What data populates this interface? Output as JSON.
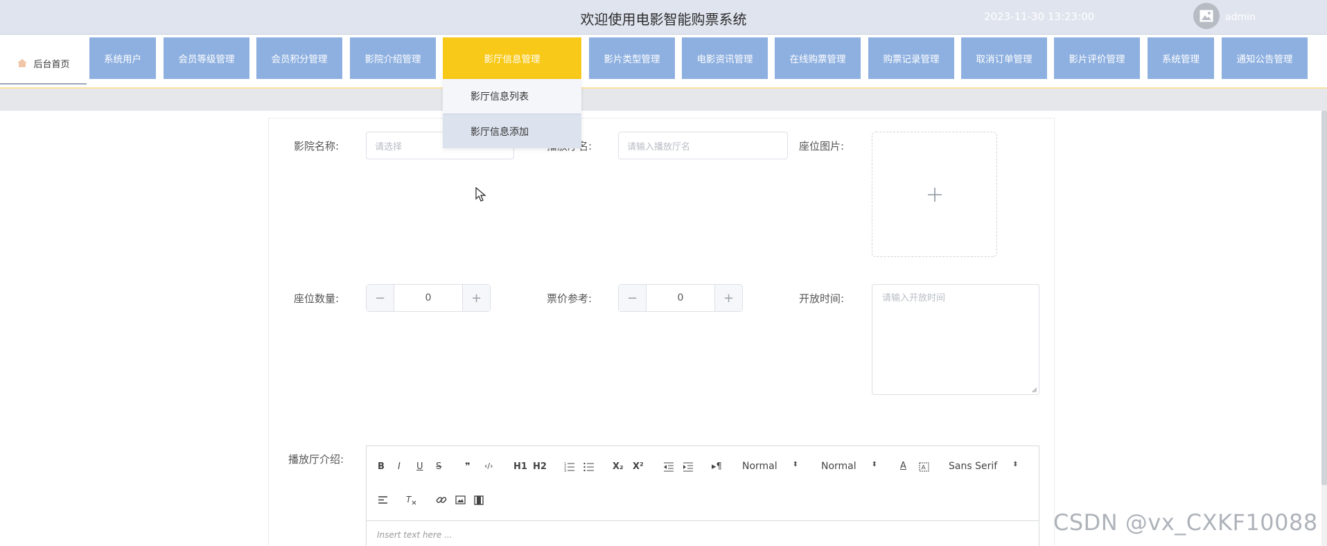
{
  "header": {
    "title": "欢迎使用电影智能购票系统",
    "datetime": "2023-11-30 13:23:00",
    "username": "admin"
  },
  "nav": {
    "home_label": "后台首页",
    "items": [
      {
        "label": "系统用户"
      },
      {
        "label": "会员等级管理"
      },
      {
        "label": "会员积分管理"
      },
      {
        "label": "影院介绍管理"
      },
      {
        "label": "影厅信息管理",
        "active": true
      },
      {
        "label": "影片类型管理"
      },
      {
        "label": "电影资讯管理"
      },
      {
        "label": "在线购票管理"
      },
      {
        "label": "购票记录管理"
      },
      {
        "label": "取消订单管理"
      },
      {
        "label": "影片评价管理"
      },
      {
        "label": "系统管理"
      },
      {
        "label": "通知公告管理"
      }
    ],
    "dropdown": [
      {
        "label": "影厅信息列表"
      },
      {
        "label": "影厅信息添加"
      }
    ]
  },
  "form": {
    "cinema_name": {
      "label": "影院名称:",
      "placeholder": "请选择"
    },
    "hall_name": {
      "label": "播放厅名:",
      "placeholder": "请输入播放厅名"
    },
    "seat_image": {
      "label": "座位图片:"
    },
    "seat_count": {
      "label": "座位数量:",
      "value": "0"
    },
    "price_ref": {
      "label": "票价参考:",
      "value": "0"
    },
    "open_time": {
      "label": "开放时间:",
      "placeholder": "请输入开放时间"
    },
    "hall_intro": {
      "label": "播放厅介绍:"
    }
  },
  "editor": {
    "toolbar": {
      "bold": "B",
      "italic": "I",
      "underline": "U",
      "strike": "S",
      "quote": "❞",
      "code": "‹/›",
      "h1": "H1",
      "h2": "H2",
      "sub": "X₂",
      "sup": "X²",
      "rtl": "▸¶",
      "size_select": "Normal",
      "header_select": "Normal",
      "font_select": "Sans Serif",
      "color": "A"
    },
    "placeholder": "Insert text here ..."
  },
  "watermark": "CSDN @vx_CXKF10088"
}
